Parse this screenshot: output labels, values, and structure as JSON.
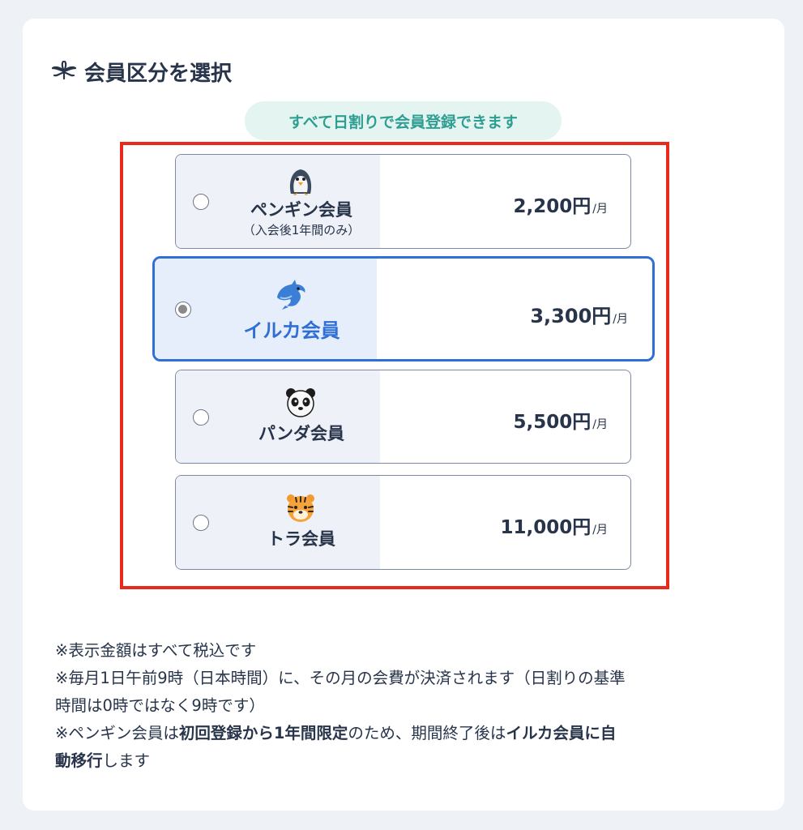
{
  "section": {
    "title": "会員区分を選択",
    "title_icon": "cannabis-leaf-icon"
  },
  "notice_pill": "すべて日割りで会員登録できます",
  "plans": [
    {
      "name": "ペンギン会員",
      "note": "（入会後1年間のみ）",
      "price": "2,200円",
      "unit": "/月",
      "icon": "penguin-icon",
      "selected": false
    },
    {
      "name": "イルカ会員",
      "note": "",
      "price": "3,300円",
      "unit": "/月",
      "icon": "dolphin-icon",
      "selected": true
    },
    {
      "name": "パンダ会員",
      "note": "",
      "price": "5,500円",
      "unit": "/月",
      "icon": "panda-icon",
      "selected": false
    },
    {
      "name": "トラ会員",
      "note": "",
      "price": "11,000円",
      "unit": "/月",
      "icon": "tiger-icon",
      "selected": false
    }
  ],
  "notes": {
    "line1": "※表示金額はすべて税込です",
    "line2a": "※毎月1日午前9時（日本時間）に、その月の会費が決済されます（日割りの基準",
    "line2b": "時間は0時ではなく9時です）",
    "line3_pre": "※ペンギン会員は",
    "line3_bold1": "初回登録から1年間限定",
    "line3_mid": "のため、期間終了後は",
    "line3_bold2": "イルカ会員に自",
    "line4_bold": "動移行",
    "line4_post": "します"
  },
  "colors": {
    "accent": "#2f6fd6",
    "pill_text": "#2f9e92",
    "pill_bg": "#e4f4f1",
    "highlight_frame": "#e8291c",
    "text": "#27344a"
  }
}
